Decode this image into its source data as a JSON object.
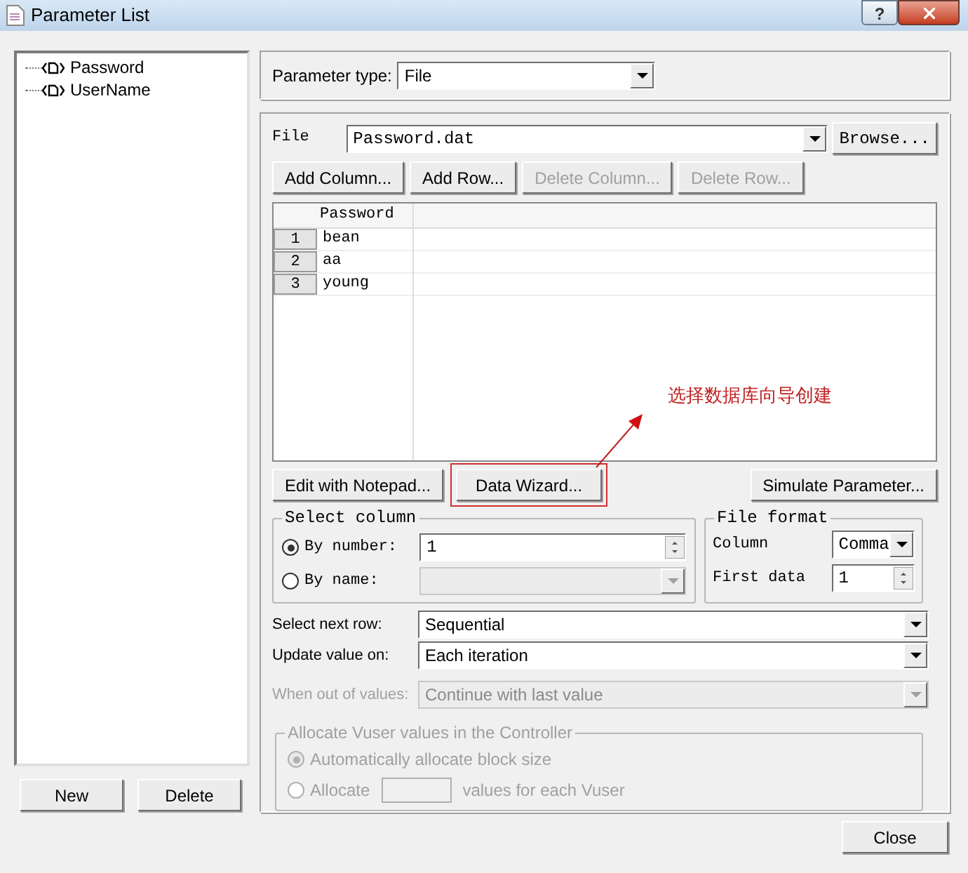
{
  "window": {
    "title": "Parameter List",
    "help": "?"
  },
  "parameters": [
    {
      "name": "Password"
    },
    {
      "name": "UserName"
    }
  ],
  "left_buttons": [
    "New",
    "Delete"
  ],
  "parameter_type": {
    "label": "Parameter type:",
    "value": "File"
  },
  "file": {
    "label": "File",
    "value": "Password.dat",
    "browse": "Browse..."
  },
  "table_buttons": [
    {
      "label": "Add Column...",
      "disabled": false
    },
    {
      "label": "Add Row...",
      "disabled": false
    },
    {
      "label": "Delete Column...",
      "disabled": true
    },
    {
      "label": "Delete Row...",
      "disabled": true
    }
  ],
  "table": {
    "columns": [
      "Password"
    ],
    "rows": [
      {
        "number": "1",
        "value": "bean"
      },
      {
        "number": "2",
        "value": "aa"
      },
      {
        "number": "3",
        "value": "young"
      }
    ]
  },
  "action_buttons": [
    {
      "label": "Edit with Notepad...",
      "kind": "plain"
    },
    {
      "label": "Data Wizard...",
      "kind": "framed"
    },
    {
      "label": "Simulate Parameter...",
      "kind": "plain"
    }
  ],
  "annotation": {
    "text": "选择数据库向导创建"
  },
  "select_column": {
    "title": "Select column",
    "options": [
      {
        "label": "By number:",
        "selected": true,
        "kind": "spin",
        "value": "1",
        "disabled": false
      },
      {
        "label": "By name:",
        "selected": false,
        "kind": "combo",
        "disabled": true
      }
    ]
  },
  "file_format": {
    "title": "File format",
    "column": {
      "label": "Column",
      "value": "Comma"
    },
    "first_data": {
      "label": "First data",
      "value": "1"
    }
  },
  "row_settings": [
    {
      "label": "Select next row:",
      "value": "Sequential",
      "disabled": false
    },
    {
      "label": "Update value on:",
      "value": "Each iteration",
      "disabled": false
    },
    {
      "label": "When out of values:",
      "value": "Continue with last value",
      "disabled": true
    }
  ],
  "allocate": {
    "title": "Allocate Vuser values in the Controller",
    "disabled": true,
    "options": [
      {
        "label": "Automatically allocate block size",
        "selected": true,
        "kind": "plain"
      },
      {
        "label": "Allocate",
        "selected": false,
        "kind": "amount",
        "suffix": "values for each Vuser"
      }
    ]
  },
  "close_button": "Close"
}
